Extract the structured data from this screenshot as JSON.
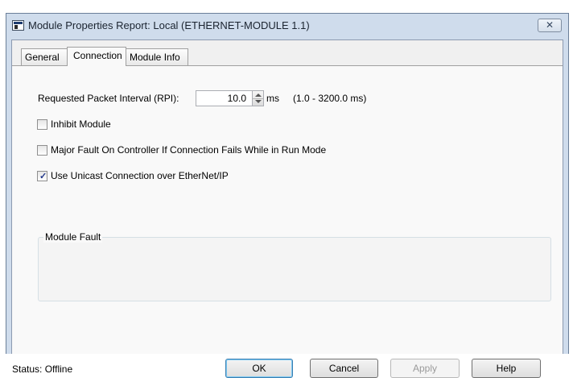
{
  "window": {
    "title": "Module Properties Report: Local (ETHERNET-MODULE 1.1)",
    "close_glyph": "✕"
  },
  "tabs": [
    {
      "label": "General",
      "active": false
    },
    {
      "label": "Connection",
      "active": true
    },
    {
      "label": "Module Info",
      "active": false
    }
  ],
  "connection": {
    "rpi_label": "Requested Packet Interval (RPI):",
    "rpi_value": "10.0",
    "rpi_unit": "ms",
    "rpi_range": "(1.0 - 3200.0 ms)",
    "inhibit_label": "Inhibit Module",
    "inhibit_checked": false,
    "major_fault_label": "Major Fault On Controller If Connection Fails While in Run Mode",
    "major_fault_checked": false,
    "unicast_label": "Use Unicast Connection over EtherNet/IP",
    "unicast_checked": true,
    "module_fault_title": "Module Fault"
  },
  "status": {
    "text": "Status:  Offline"
  },
  "buttons": {
    "ok": "OK",
    "cancel": "Cancel",
    "apply": "Apply",
    "help": "Help"
  },
  "colors": {
    "frame": "#cfdcec",
    "panel": "#f9f9f9",
    "check": "#21378a"
  }
}
